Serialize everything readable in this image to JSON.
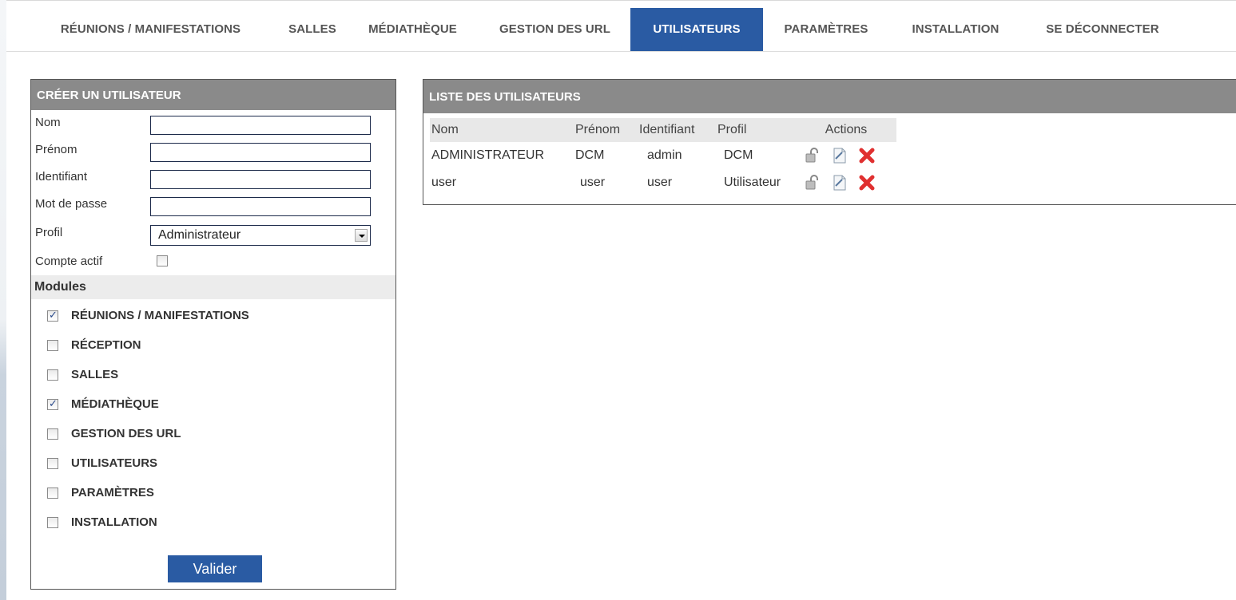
{
  "nav": {
    "items": [
      {
        "label": "RÉUNIONS / MANIFESTATIONS",
        "active": false
      },
      {
        "label": "SALLES",
        "active": false
      },
      {
        "label": "MÉDIATHÈQUE",
        "active": false
      },
      {
        "label": "GESTION DES URL",
        "active": false
      },
      {
        "label": "UTILISATEURS",
        "active": true
      },
      {
        "label": "PARAMÈTRES",
        "active": false
      },
      {
        "label": "INSTALLATION",
        "active": false
      },
      {
        "label": "SE DÉCONNECTER",
        "active": false
      }
    ]
  },
  "create_form": {
    "title": "CRÉER UN UTILISATEUR",
    "nom_label": "Nom",
    "prenom_label": "Prénom",
    "identifiant_label": "Identifiant",
    "password_label": "Mot de passe",
    "profil_label": "Profil",
    "profil_value": "Administrateur",
    "actif_label": "Compte actif",
    "actif_checked": false,
    "modules_title": "Modules",
    "modules": [
      {
        "label": "RÉUNIONS / MANIFESTATIONS",
        "checked": true
      },
      {
        "label": "RÉCEPTION",
        "checked": false
      },
      {
        "label": "SALLES",
        "checked": false
      },
      {
        "label": "MÉDIATHÈQUE",
        "checked": true
      },
      {
        "label": "GESTION DES URL",
        "checked": false
      },
      {
        "label": "UTILISATEURS",
        "checked": false
      },
      {
        "label": "PARAMÈTRES",
        "checked": false
      },
      {
        "label": "INSTALLATION",
        "checked": false
      }
    ],
    "submit_label": "Valider"
  },
  "user_list": {
    "title": "LISTE DES UTILISATEURS",
    "columns": [
      "Nom",
      "Prénom",
      "Identifiant",
      "Profil",
      "Actions"
    ],
    "rows": [
      {
        "nom": "ADMINISTRATEUR",
        "prenom": "DCM",
        "identifiant": "admin",
        "profil": "DCM"
      },
      {
        "nom": "user",
        "prenom": "user",
        "identifiant": "user",
        "profil": "Utilisateur"
      }
    ],
    "action_icons": [
      "lock-icon",
      "edit-icon",
      "delete-icon"
    ]
  },
  "colors": {
    "accent": "#2a5ba3",
    "panel_header": "#8a8a8a",
    "delete": "#e03030"
  }
}
